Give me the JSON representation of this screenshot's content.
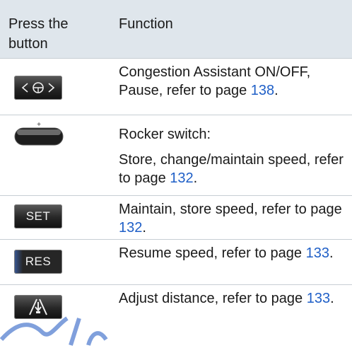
{
  "header": {
    "col1": "Press the\nbutton",
    "col2": "Function"
  },
  "rows": [
    {
      "icon": "congestion-assistant-icon",
      "lines": [
        {
          "text": "Congestion Assistant ON/OFF, Pause, refer to page ",
          "page": "138",
          "after": "."
        }
      ]
    },
    {
      "icon": "rocker-switch-icon",
      "lines": [
        {
          "text": "Rocker switch:",
          "page": "",
          "after": ""
        },
        {
          "text": "Store, change/maintain speed, refer to page ",
          "page": "132",
          "after": "."
        }
      ]
    },
    {
      "icon": "set-button-icon",
      "label": "SET",
      "lines": [
        {
          "text": "Maintain, store speed, refer to page ",
          "page": "132",
          "after": "."
        }
      ]
    },
    {
      "icon": "res-button-icon",
      "label": "RES",
      "lines": [
        {
          "text": "Resume speed, refer to page ",
          "page": "133",
          "after": "."
        }
      ]
    },
    {
      "icon": "distance-button-icon",
      "lines": [
        {
          "text": "Adjust distance, refer to page ",
          "page": "133",
          "after": "."
        }
      ]
    }
  ],
  "colors": {
    "header_bg": "#dfe6ec",
    "link": "#1f5fc7",
    "watermark": "#6a8fd6"
  }
}
